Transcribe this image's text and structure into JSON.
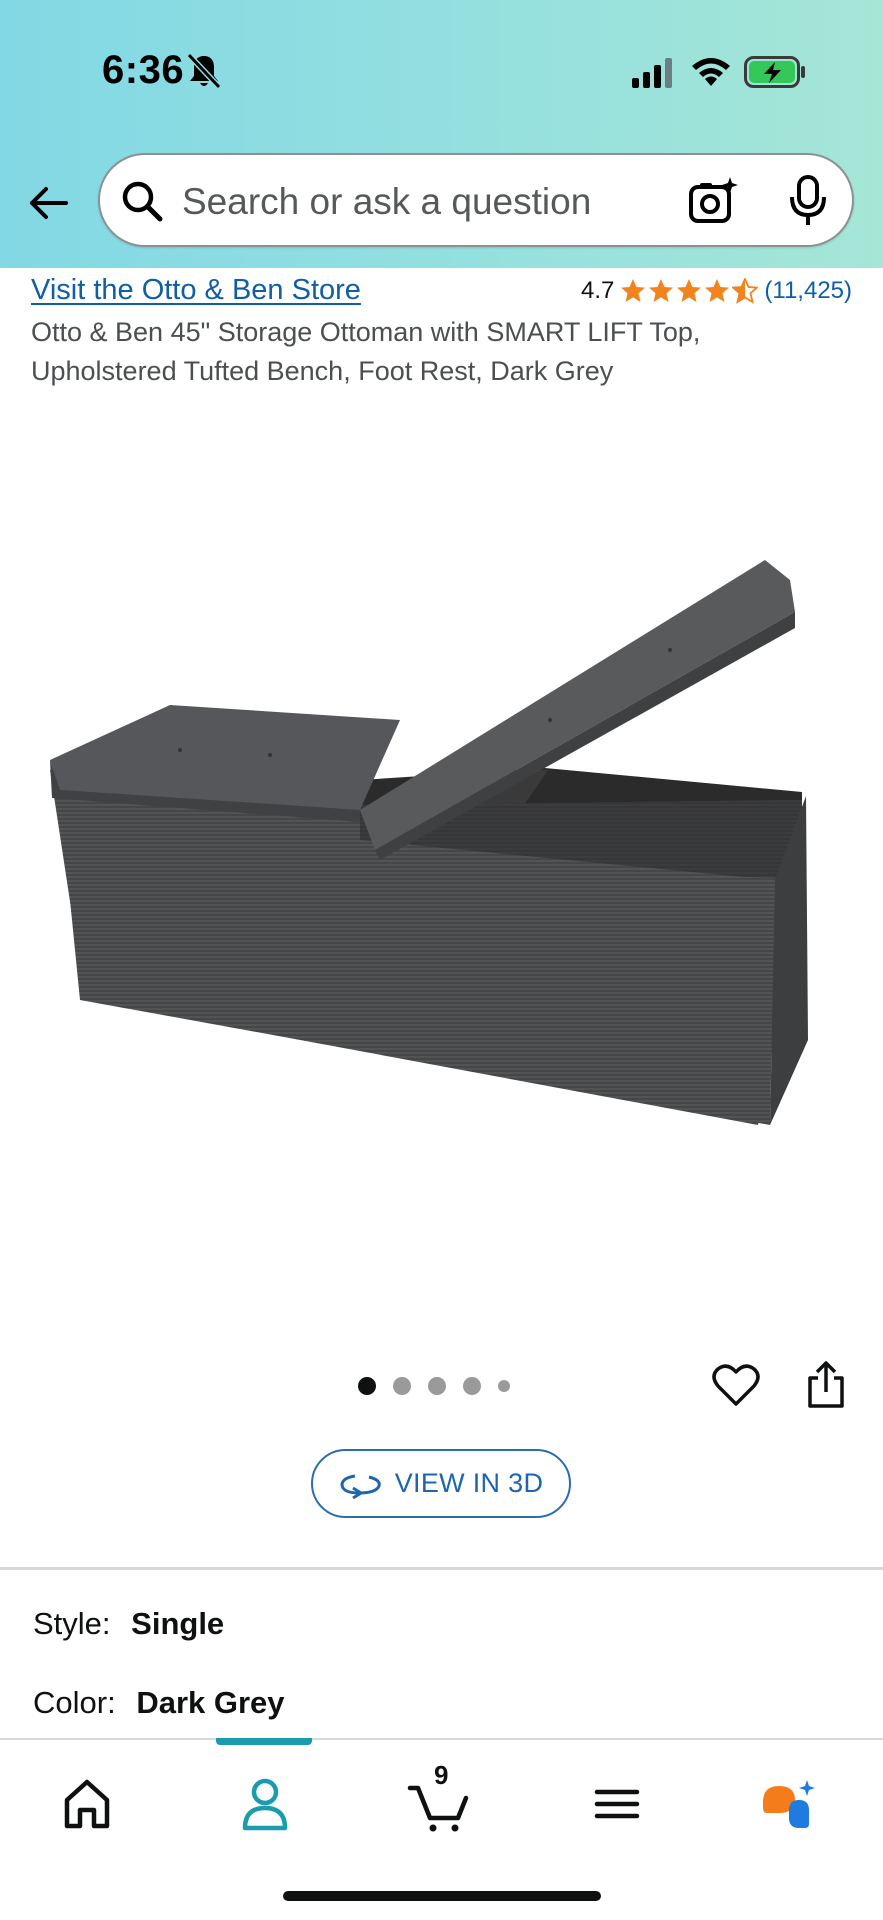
{
  "status_bar": {
    "time": "6:36"
  },
  "search": {
    "placeholder": "Search or ask a question"
  },
  "product": {
    "store_link": "Visit the Otto & Ben Store",
    "rating_value": "4.7",
    "rating_stars": 4.5,
    "rating_count": "(11,425)",
    "title": "Otto & Ben 45\" Storage Ottoman with SMART LIFT Top, Upholstered Tufted Bench, Foot Rest, Dark Grey",
    "image_count": 5,
    "active_image_index": 0
  },
  "view3d": {
    "label": "VIEW IN 3D"
  },
  "options": {
    "style_label": "Style:",
    "style_value": "Single",
    "color_label": "Color:",
    "color_value": "Dark Grey"
  },
  "nav": {
    "items": [
      {
        "name": "home",
        "icon": "home-icon"
      },
      {
        "name": "account",
        "icon": "person-icon",
        "active": true
      },
      {
        "name": "cart",
        "icon": "cart-icon",
        "count": "9"
      },
      {
        "name": "menu",
        "icon": "menu-icon"
      },
      {
        "name": "rufus",
        "icon": "rufus-chat-icon"
      }
    ]
  },
  "colors": {
    "link": "#0f5fa6",
    "star": "#f1841d",
    "accent": "#1a9cae",
    "button_border": "#2b6cb0"
  }
}
